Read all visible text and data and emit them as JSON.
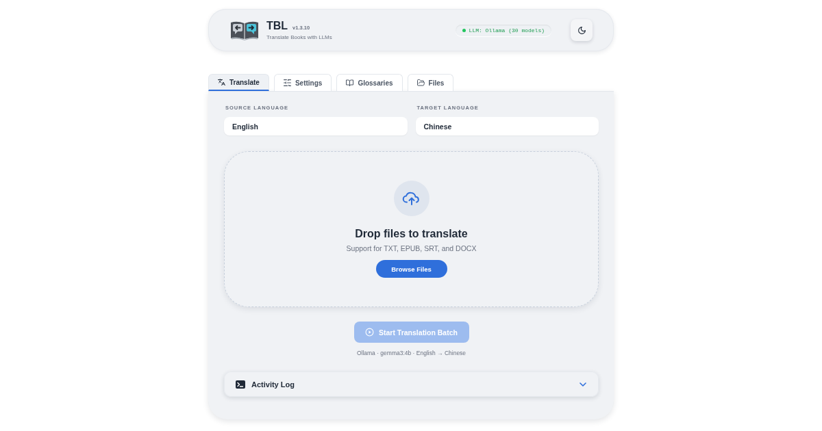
{
  "app": {
    "title": "TBL",
    "version": "v1.3.10",
    "subtitle": "Translate Books with LLMs"
  },
  "llm_status": {
    "label": "LLM: Ollama (30 models)",
    "connected": true
  },
  "tabs": [
    {
      "kind": "translate",
      "label": "Translate",
      "selected": true
    },
    {
      "kind": "settings",
      "label": "Settings",
      "selected": false
    },
    {
      "kind": "glossaries",
      "label": "Glossaries",
      "selected": false
    },
    {
      "kind": "files",
      "label": "Files",
      "selected": false
    }
  ],
  "source_language": {
    "label": "SOURCE LANGUAGE",
    "value": "English"
  },
  "target_language": {
    "label": "TARGET LANGUAGE",
    "value": "Chinese"
  },
  "drop_zone": {
    "title": "Drop files to translate",
    "subtitle": "Support for TXT, EPUB, SRT, and DOCX",
    "button": "Browse Files"
  },
  "start_button": {
    "label": "Start Translation Batch",
    "disabled": true
  },
  "summary": "Ollama · gemma3:4b · English → Chinese",
  "activity_log": {
    "title": "Activity Log",
    "expanded": false
  }
}
